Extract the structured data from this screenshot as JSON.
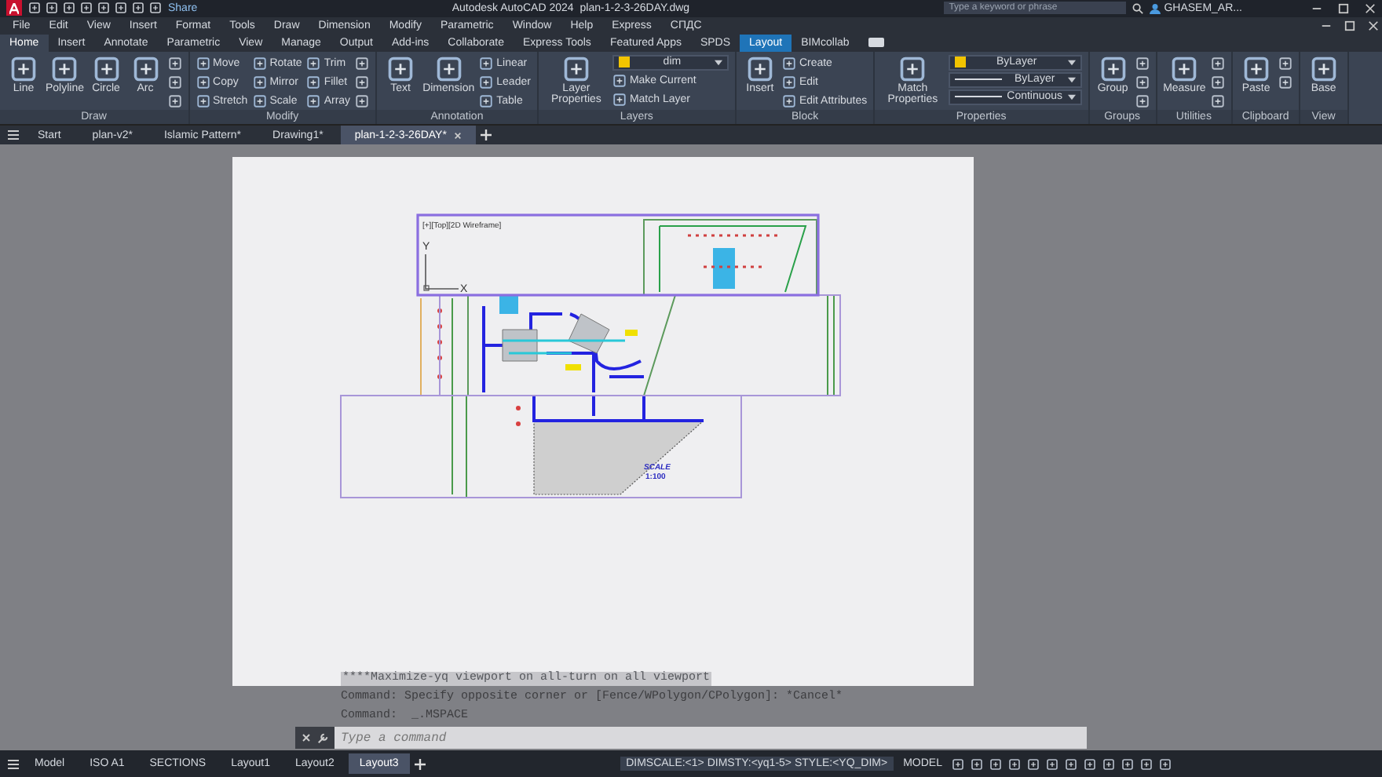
{
  "title_bar": {
    "share": "Share",
    "app_name": "Autodesk AutoCAD 2024",
    "file_name": "plan-1-2-3-26DAY.dwg",
    "search": {
      "placeholder": "Type a keyword or phrase"
    },
    "user": "GHASEM_AR..."
  },
  "menu_bar": [
    "File",
    "Edit",
    "View",
    "Insert",
    "Format",
    "Tools",
    "Draw",
    "Dimension",
    "Modify",
    "Parametric",
    "Window",
    "Help",
    "Express",
    "СПДС"
  ],
  "ribbon_tabs": [
    {
      "label": "Home",
      "selected": true,
      "kind": "normal"
    },
    {
      "label": "Insert",
      "selected": false,
      "kind": "normal"
    },
    {
      "label": "Annotate",
      "selected": false,
      "kind": "normal"
    },
    {
      "label": "Parametric",
      "selected": false,
      "kind": "normal"
    },
    {
      "label": "View",
      "selected": false,
      "kind": "normal"
    },
    {
      "label": "Manage",
      "selected": false,
      "kind": "normal"
    },
    {
      "label": "Output",
      "selected": false,
      "kind": "normal"
    },
    {
      "label": "Add-ins",
      "selected": false,
      "kind": "normal"
    },
    {
      "label": "Collaborate",
      "selected": false,
      "kind": "normal"
    },
    {
      "label": "Express Tools",
      "selected": false,
      "kind": "normal"
    },
    {
      "label": "Featured Apps",
      "selected": false,
      "kind": "normal"
    },
    {
      "label": "SPDS",
      "selected": false,
      "kind": "normal"
    },
    {
      "label": "Layout",
      "selected": false,
      "kind": "contextual"
    },
    {
      "label": "BIMcollab",
      "selected": false,
      "kind": "normal"
    }
  ],
  "ribbon_panels": [
    {
      "title": "Draw",
      "items": [
        {
          "kind": "large",
          "label": "Line"
        },
        {
          "kind": "large",
          "label": "Polyline"
        },
        {
          "kind": "large",
          "label": "Circle"
        },
        {
          "kind": "large",
          "label": "Arc"
        },
        {
          "kind": "stack",
          "tools": [
            {
              "kind": "icon"
            },
            {
              "kind": "icon"
            },
            {
              "kind": "icon"
            }
          ]
        }
      ]
    },
    {
      "title": "Modify",
      "items": [
        {
          "kind": "stack",
          "tools": [
            {
              "kind": "small",
              "label": "Move"
            },
            {
              "kind": "small",
              "label": "Copy"
            },
            {
              "kind": "small",
              "label": "Stretch"
            }
          ]
        },
        {
          "kind": "stack",
          "tools": [
            {
              "kind": "small",
              "label": "Rotate"
            },
            {
              "kind": "small",
              "label": "Mirror"
            },
            {
              "kind": "small",
              "label": "Scale"
            }
          ]
        },
        {
          "kind": "stack",
          "tools": [
            {
              "kind": "small",
              "label": "Trim"
            },
            {
              "kind": "small",
              "label": "Fillet"
            },
            {
              "kind": "small",
              "label": "Array"
            }
          ]
        },
        {
          "kind": "stack",
          "tools": [
            {
              "kind": "icon"
            },
            {
              "kind": "icon"
            },
            {
              "kind": "icon"
            }
          ]
        }
      ]
    },
    {
      "title": "Annotation",
      "items": [
        {
          "kind": "large",
          "label": "Text"
        },
        {
          "kind": "large",
          "label": "Dimension"
        },
        {
          "kind": "stack",
          "tools": [
            {
              "kind": "small",
              "label": "Linear"
            },
            {
              "kind": "small",
              "label": "Leader"
            },
            {
              "kind": "small",
              "label": "Table"
            }
          ]
        }
      ]
    },
    {
      "title": "Layers",
      "items": [
        {
          "kind": "large",
          "label": "Layer Properties"
        },
        {
          "kind": "stack",
          "tools": [
            {
              "kind": "layer-dropdown",
              "value": "dim"
            },
            {
              "kind": "small",
              "label": "Make Current"
            },
            {
              "kind": "small",
              "label": "Match Layer"
            }
          ]
        }
      ]
    },
    {
      "title": "Block",
      "items": [
        {
          "kind": "large",
          "label": "Insert"
        },
        {
          "kind": "stack",
          "tools": [
            {
              "kind": "small",
              "label": "Create"
            },
            {
              "kind": "small",
              "label": "Edit"
            },
            {
              "kind": "small",
              "label": "Edit Attributes"
            }
          ]
        }
      ]
    },
    {
      "title": "Properties",
      "items": [
        {
          "kind": "large",
          "label": "Match Properties"
        },
        {
          "kind": "stack",
          "tools": [
            {
              "kind": "swatch-dropdown",
              "value": "ByLayer"
            },
            {
              "kind": "line-dropdown",
              "value": "ByLayer"
            },
            {
              "kind": "line-dropdown",
              "value": "Continuous"
            }
          ]
        }
      ]
    },
    {
      "title": "Groups",
      "items": [
        {
          "kind": "large",
          "label": "Group"
        },
        {
          "kind": "stack",
          "tools": [
            {
              "kind": "icon"
            },
            {
              "kind": "icon"
            },
            {
              "kind": "icon"
            }
          ]
        }
      ]
    },
    {
      "title": "Utilities",
      "items": [
        {
          "kind": "large",
          "label": "Measure"
        },
        {
          "kind": "stack",
          "tools": [
            {
              "kind": "icon"
            },
            {
              "kind": "icon"
            },
            {
              "kind": "icon"
            }
          ]
        }
      ]
    },
    {
      "title": "Clipboard",
      "items": [
        {
          "kind": "large",
          "label": "Paste"
        },
        {
          "kind": "stack",
          "tools": [
            {
              "kind": "icon"
            },
            {
              "kind": "icon"
            }
          ]
        }
      ]
    },
    {
      "title": "View",
      "items": [
        {
          "kind": "large",
          "label": "Base"
        }
      ]
    }
  ],
  "file_tabs": [
    {
      "label": "Start",
      "selected": false
    },
    {
      "label": "plan-v2*",
      "selected": false
    },
    {
      "label": "Islamic Pattern*",
      "selected": false
    },
    {
      "label": "Drawing1*",
      "selected": false
    },
    {
      "label": "plan-1-2-3-26DAY*",
      "selected": true
    }
  ],
  "layout": {
    "viewport_label": "[+][Top][2D Wireframe]",
    "ucs": {
      "y": "Y",
      "x": "X"
    },
    "scale_title": "SCALE",
    "scale": "1:100"
  },
  "command_history": [
    "****Maximize-yq viewport on all-turn on all viewport",
    "Command: Specify opposite corner or [Fence/WPolygon/CPolygon]: *Cancel*",
    "Command:  _.MSPACE"
  ],
  "command_line": {
    "placeholder": "Type a command"
  },
  "layout_tabs": [
    {
      "label": "Model",
      "selected": false
    },
    {
      "label": "ISO A1",
      "selected": false
    },
    {
      "label": "SECTIONS",
      "selected": false
    },
    {
      "label": "Layout1",
      "selected": false
    },
    {
      "label": "Layout2",
      "selected": false
    },
    {
      "label": "Layout3",
      "selected": true
    }
  ],
  "status_bar": {
    "dim_info": "DIMSCALE:<1> DIMSTY:<yq1-5> STYLE:<YQ_DIM>",
    "space": "MODEL"
  }
}
